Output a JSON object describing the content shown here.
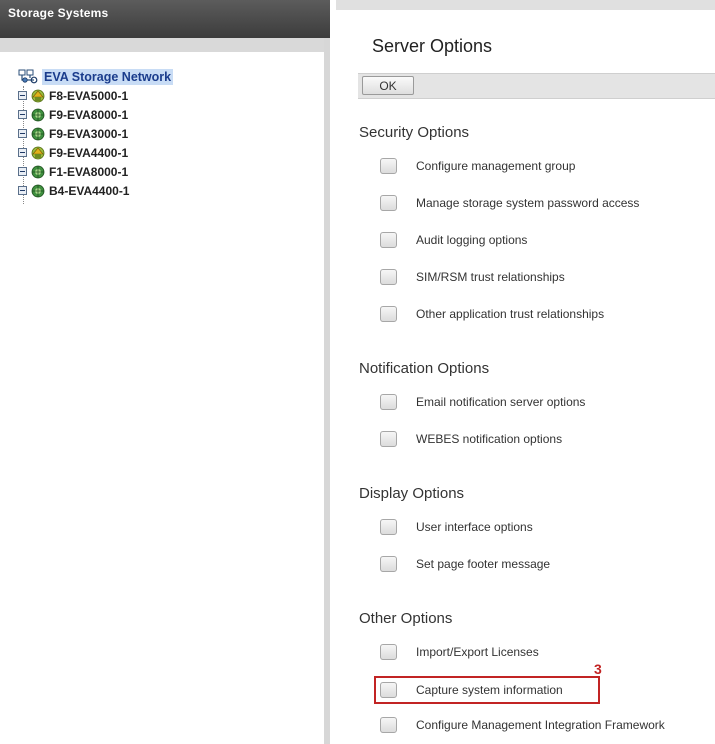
{
  "left": {
    "header_title": "Storage Systems",
    "root_label": "EVA Storage Network",
    "items": [
      {
        "label": "F8-EVA5000-1",
        "icon": "eva-warning-icon"
      },
      {
        "label": "F9-EVA8000-1",
        "icon": "eva-normal-icon"
      },
      {
        "label": "F9-EVA3000-1",
        "icon": "eva-normal-icon"
      },
      {
        "label": "F9-EVA4400-1",
        "icon": "eva-warning-icon"
      },
      {
        "label": "F1-EVA8000-1",
        "icon": "eva-normal-icon"
      },
      {
        "label": "B4-EVA4400-1",
        "icon": "eva-normal-icon"
      }
    ]
  },
  "right": {
    "title": "Server Options",
    "ok_label": "OK",
    "sections": [
      {
        "heading": "Security Options",
        "options": [
          "Configure management group",
          "Manage storage system password access",
          "Audit logging options",
          "SIM/RSM trust relationships",
          "Other application trust relationships"
        ]
      },
      {
        "heading": "Notification Options",
        "options": [
          "Email notification server options",
          "WEBES notification options"
        ]
      },
      {
        "heading": "Display Options",
        "options": [
          "User interface options",
          "Set page footer message"
        ]
      },
      {
        "heading": "Other Options",
        "options": [
          "Import/Export Licenses",
          "Capture system information",
          "Configure Management Integration Framework"
        ]
      }
    ],
    "callout": "3"
  },
  "colors": {
    "accent_red": "#c22424",
    "selection_blue": "#c8dcf5",
    "header_dark": "#4a4a4a"
  }
}
